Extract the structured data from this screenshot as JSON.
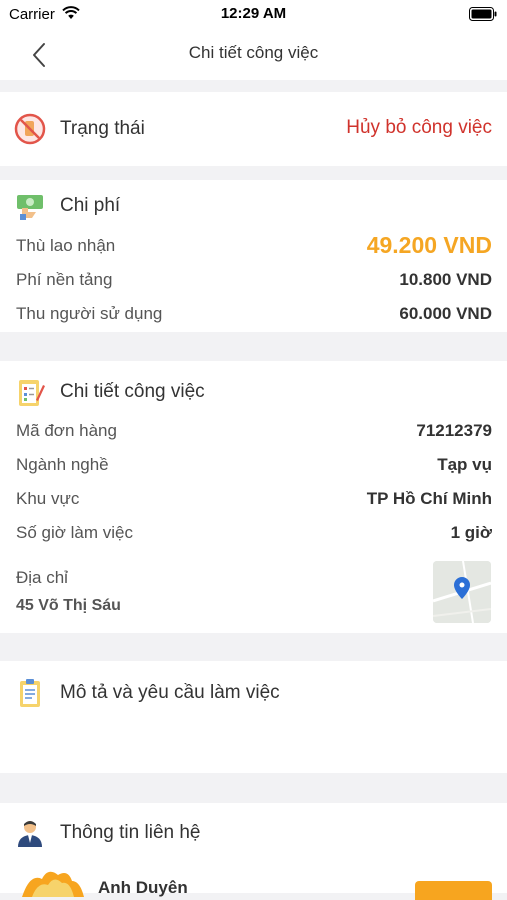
{
  "status_bar": {
    "carrier": "Carrier",
    "time": "12:29 AM"
  },
  "nav": {
    "title": "Chi tiết công việc"
  },
  "status": {
    "label": "Trạng thái",
    "value": "Hủy bỏ công việc"
  },
  "cost": {
    "title": "Chi phí",
    "rows": [
      {
        "label": "Thù lao nhận",
        "value": "49.200 VND"
      },
      {
        "label": "Phí nền tảng",
        "value": "10.800 VND"
      },
      {
        "label": "Thu người sử dụng",
        "value": "60.000 VND"
      }
    ]
  },
  "detail": {
    "title": "Chi tiết công việc",
    "rows": [
      {
        "label": "Mã đơn hàng",
        "value": "71212379"
      },
      {
        "label": "Ngành nghề",
        "value": "Tạp vụ"
      },
      {
        "label": "Khu vực",
        "value": "TP Hồ Chí Minh"
      },
      {
        "label": "Số giờ làm việc",
        "value": "1 giờ"
      }
    ],
    "address_label": "Địa chỉ",
    "address": "45 Võ Thị Sáu"
  },
  "description": {
    "title": "Mô tả và yêu cầu làm việc"
  },
  "contact": {
    "title": "Thông tin liên hệ",
    "name": "Anh Duyên"
  },
  "colors": {
    "accent": "#f5a623",
    "danger": "#d0332c"
  },
  "icons": {
    "back": "chevron-left-icon",
    "status": "cancel-icon",
    "cost": "money-icon",
    "detail": "checklist-icon",
    "description": "clipboard-icon",
    "contact": "person-icon",
    "map": "map-pin-icon"
  }
}
